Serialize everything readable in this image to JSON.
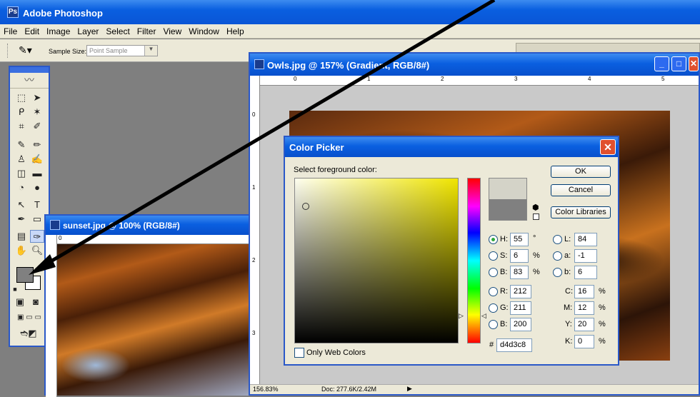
{
  "app": {
    "title": "Adobe Photoshop",
    "menu": [
      "File",
      "Edit",
      "Image",
      "Layer",
      "Select",
      "Filter",
      "View",
      "Window",
      "Help"
    ]
  },
  "options_bar": {
    "sample_size_label": "Sample Size:",
    "sample_size_value": "Point Sample"
  },
  "toolbox": {
    "foreground_color": "#808080",
    "background_color": "#ffffff"
  },
  "owls_window": {
    "title": "Owls.jpg @ 157% (Gradient, RGB/8#)",
    "ruler_h": [
      "0",
      "1",
      "2",
      "3",
      "4",
      "5"
    ],
    "ruler_v": [
      "0",
      "1",
      "2",
      "3"
    ],
    "status_zoom": "156.83%",
    "status_doc": "Doc: 277.6K/2.42M"
  },
  "sunset_window": {
    "title": "sunset.jpg @ 100% (RGB/8#)",
    "ruler_h": [
      "0"
    ]
  },
  "color_picker": {
    "title": "Color Picker",
    "prompt": "Select foreground color:",
    "ok": "OK",
    "cancel": "Cancel",
    "libraries": "Color Libraries",
    "hsb": {
      "h_label": "H:",
      "h": "55",
      "h_unit": "°",
      "s_label": "S:",
      "s": "6",
      "s_unit": "%",
      "b_label": "B:",
      "b": "83",
      "b_unit": "%"
    },
    "rgb": {
      "r_label": "R:",
      "r": "212",
      "g_label": "G:",
      "g": "211",
      "b_label": "B:",
      "b": "200"
    },
    "lab": {
      "l_label": "L:",
      "l": "84",
      "a_label": "a:",
      "a": "-1",
      "b_label": "b:",
      "b": "6"
    },
    "cmyk": {
      "c_label": "C:",
      "c": "16",
      "m_label": "M:",
      "m": "12",
      "y_label": "Y:",
      "y": "20",
      "k_label": "K:",
      "k": "0",
      "unit": "%"
    },
    "hex_label": "#",
    "hex": "d4d3c8",
    "only_web_colors": "Only Web Colors",
    "new_color": "#d4d3c8",
    "current_color": "#808080"
  }
}
